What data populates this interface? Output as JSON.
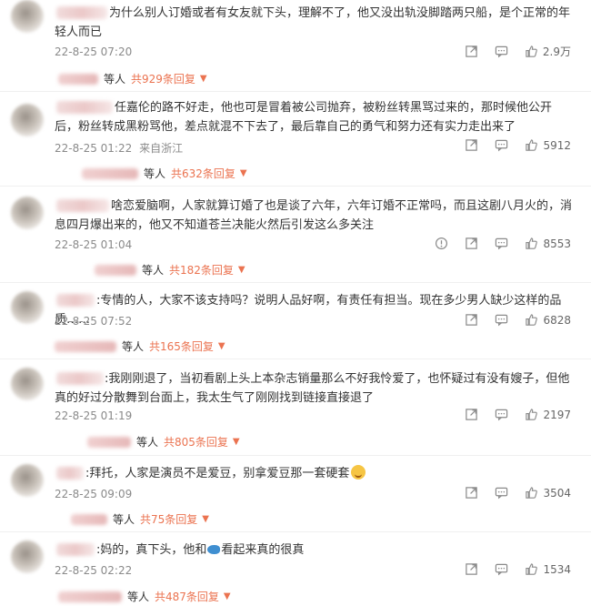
{
  "comments": [
    {
      "text": "为什么别人订婚或者有女友就下头，理解不了，他又没出轨没脚踏两只船，是个正常的年轻人而已",
      "timestamp": "22-8-25 07:20",
      "location": "",
      "likes": "2.9万",
      "reply_prefix": "等人",
      "reply_count": "共929条回复"
    },
    {
      "text": "任嘉伦的路不好走，他也可是冒着被公司抛弃，被粉丝转黑骂过来的，那时候他公开后，粉丝转成黑粉骂他，差点就混不下去了，最后靠自己的勇气和努力还有实力走出来了",
      "timestamp": "22-8-25 01:22",
      "location": "来自浙江",
      "likes": "5912",
      "reply_prefix": "等人",
      "reply_count": "共632条回复"
    },
    {
      "text": "啥恋爱脑啊，人家就算订婚了也是谈了六年，六年订婚不正常吗，而且这剧八月火的，消息四月爆出来的，他又不知道苍兰决能火然后引发这么多关注",
      "timestamp": "22-8-25 01:04",
      "location": "",
      "likes": "8553",
      "reply_prefix": "等人",
      "reply_count": "共182条回复"
    },
    {
      "text": ":专情的人，大家不该支持吗？说明人品好啊，有责任有担当。现在多少男人缺少这样的品质……",
      "timestamp": "22-8-25 07:52",
      "location": "",
      "likes": "6828",
      "reply_prefix": "等人",
      "reply_count": "共165条回复"
    },
    {
      "text": ":我刚刚退了，当初看剧上头上本杂志销量那么不好我怜爱了，也怀疑过有没有嫂子，但他真的好过分散舞到台面上，我太生气了刚刚找到链接直接退了",
      "timestamp": "22-8-25 01:19",
      "location": "",
      "likes": "2197",
      "reply_prefix": "等人",
      "reply_count": "共805条回复"
    },
    {
      "text": ":拜托，人家是演员不是爱豆，别拿爱豆那一套硬套",
      "timestamp": "22-8-25 09:09",
      "location": "",
      "likes": "3504",
      "reply_prefix": "等人",
      "reply_count": "共75条回复"
    },
    {
      "text_a": ":妈的，真下头，他和",
      "text_b": "看起来真的很真",
      "timestamp": "22-8-25 02:22",
      "location": "",
      "likes": "1534",
      "reply_prefix": "等人",
      "reply_count": "共487条回复"
    }
  ],
  "icons": {
    "share": "share-icon",
    "comment": "comment-icon",
    "like": "like-icon",
    "report": "report-icon"
  },
  "colors": {
    "accent": "#eb7350",
    "meta": "#8a8a8a",
    "text": "#333333"
  }
}
